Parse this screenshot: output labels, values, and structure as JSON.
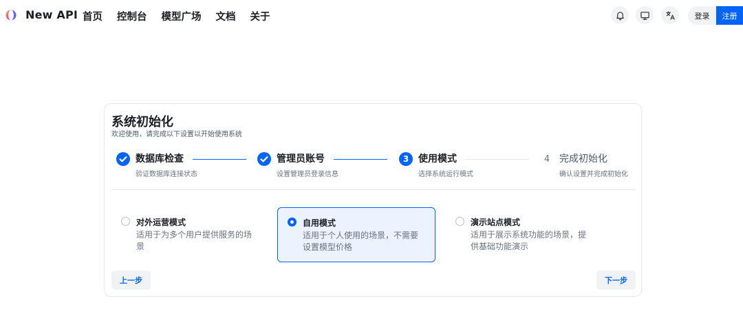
{
  "header": {
    "brand": "New API",
    "nav": [
      "首页",
      "控制台",
      "模型广场",
      "文档",
      "关于"
    ],
    "icons": [
      "bell-icon",
      "monitor-icon",
      "translate-icon"
    ],
    "login_label": "登录",
    "register_label": "注册",
    "accent_color": "#0064fa"
  },
  "setup": {
    "title": "系统初始化",
    "subtitle": "欢迎使用，请完成以下设置以开始使用系统",
    "steps": [
      {
        "number": "1",
        "title": "数据库检查",
        "desc": "验证数据库连接状态",
        "status": "done"
      },
      {
        "number": "2",
        "title": "管理员账号",
        "desc": "设置管理员登录信息",
        "status": "done"
      },
      {
        "number": "3",
        "title": "使用模式",
        "desc": "选择系统运行模式",
        "status": "active"
      },
      {
        "number": "4",
        "title": "完成初始化",
        "desc": "确认设置并完成初始化",
        "status": "wait"
      }
    ],
    "options": [
      {
        "title": "对外运营模式",
        "desc": "适用于为多个用户提供服务的场景",
        "selected": false
      },
      {
        "title": "自用模式",
        "desc": "适用于个人使用的场景，不需要设置模型价格",
        "selected": true
      },
      {
        "title": "演示站点模式",
        "desc": "适用于展示系统功能的场景，提供基础功能演示",
        "selected": false
      }
    ],
    "prev_label": "上一步",
    "next_label": "下一步"
  }
}
